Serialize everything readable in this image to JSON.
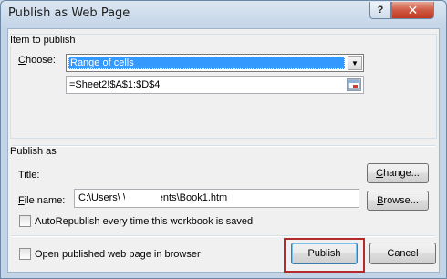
{
  "window": {
    "title": "Publish as Web Page",
    "help_label": "?",
    "close_label": "✕"
  },
  "item_to_publish": {
    "group_label": "Item to publish",
    "choose_label": "Choose:",
    "choose_value": "Range of cells",
    "range_value": "=Sheet2!$A$1:$D$4"
  },
  "publish_as": {
    "group_label": "Publish as",
    "title_label": "Title:",
    "change_button": "Change...",
    "file_name_label": "File name:",
    "file_name_value": "C:\\Users\\           \\Documents\\Book1.htm",
    "browse_button": "Browse...",
    "autorepublish_label": "AutoRepublish every time this workbook is saved",
    "autorepublish_checked": false
  },
  "footer": {
    "open_in_browser_label": "Open published web page in browser",
    "open_in_browser_checked": false,
    "publish_button": "Publish",
    "cancel_button": "Cancel"
  },
  "colors": {
    "selection": "#3399ff",
    "highlight_border": "#b42b2b",
    "close_button": "#c13b22"
  }
}
